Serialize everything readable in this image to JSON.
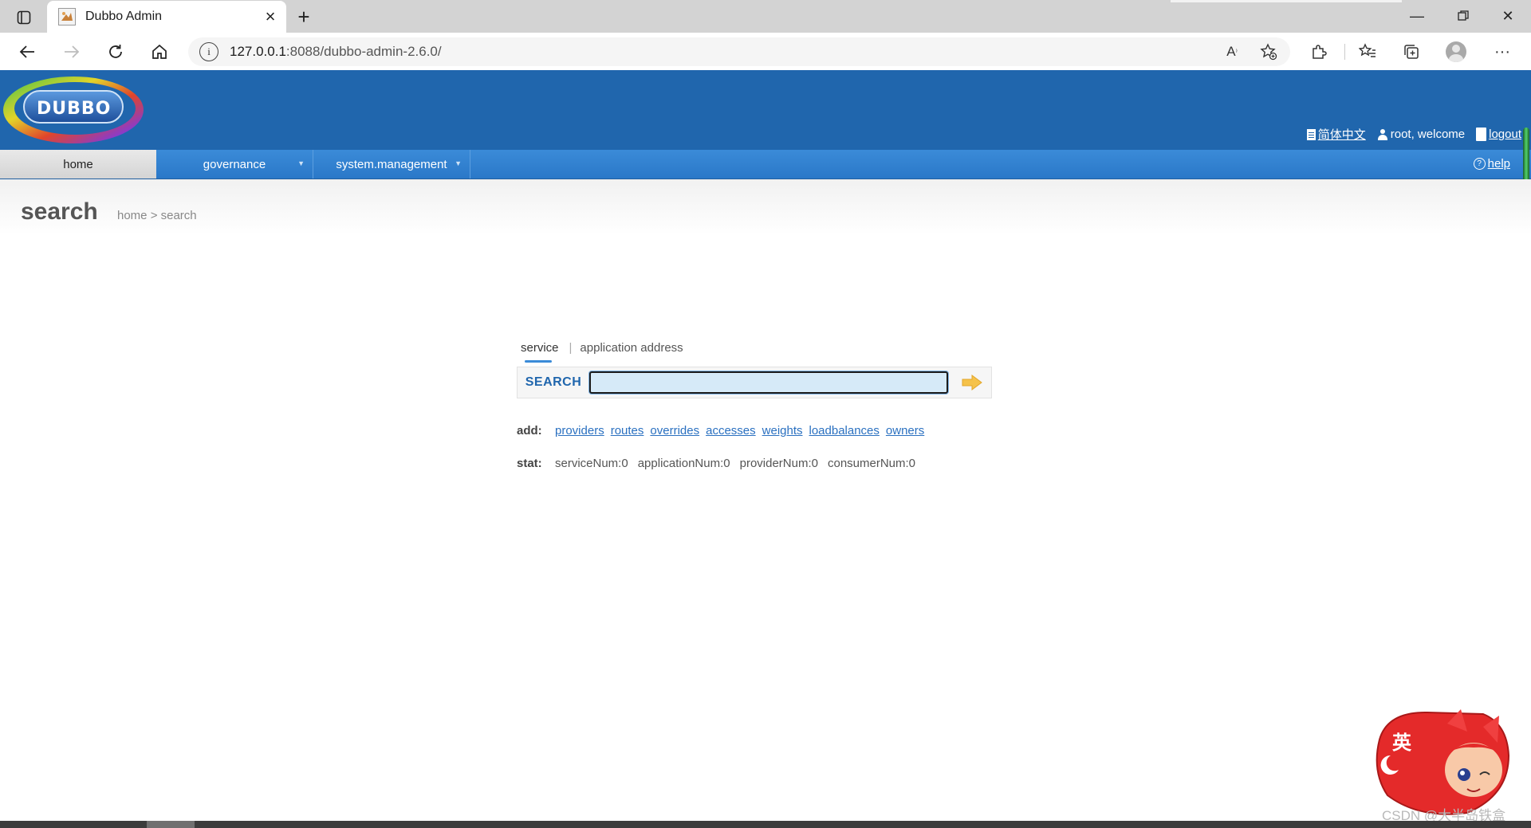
{
  "browser": {
    "tab_title": "Dubbo Admin",
    "url_host": "127.0.0.1",
    "url_rest": ":8088/dubbo-admin-2.6.0/"
  },
  "header": {
    "logo_text": "DUBBO",
    "language_link": "简体中文",
    "welcome": "root, welcome",
    "logout": "logout"
  },
  "menu": {
    "home": "home",
    "governance": "governance",
    "system_management": "system.management",
    "help": "help"
  },
  "page": {
    "title": "search",
    "breadcrumb": "home > search"
  },
  "search": {
    "tabs": [
      "service",
      "application address"
    ],
    "label": "SEARCH",
    "value": ""
  },
  "add": {
    "label": "add:",
    "links": [
      "providers",
      "routes",
      "overrides",
      "accesses",
      "weights",
      "loadbalances",
      "owners"
    ]
  },
  "stat": {
    "label": "stat:",
    "items": [
      "serviceNum:0",
      "applicationNum:0",
      "providerNum:0",
      "consumerNum:0"
    ]
  },
  "overlay": {
    "mascot_char": "英",
    "watermark": "CSDN @大半岛铁盒"
  },
  "colors": {
    "header_blue": "#2066ad",
    "menu_blue": "#3b8bd8",
    "link_blue": "#2a70c0"
  }
}
